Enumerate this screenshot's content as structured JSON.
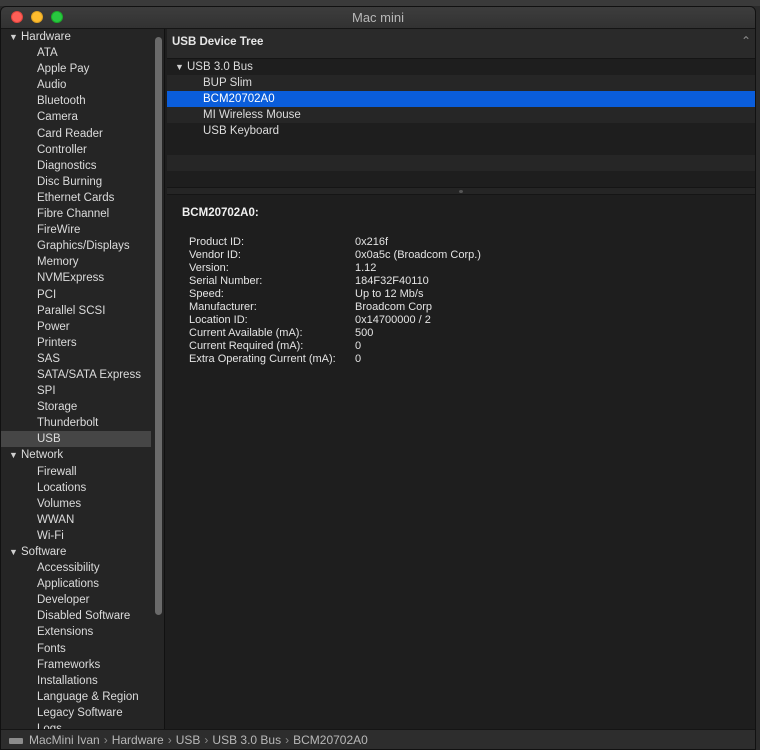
{
  "window": {
    "title": "Mac mini"
  },
  "sidebar": {
    "groups": [
      {
        "label": "Hardware",
        "items": [
          "ATA",
          "Apple Pay",
          "Audio",
          "Bluetooth",
          "Camera",
          "Card Reader",
          "Controller",
          "Diagnostics",
          "Disc Burning",
          "Ethernet Cards",
          "Fibre Channel",
          "FireWire",
          "Graphics/Displays",
          "Memory",
          "NVMExpress",
          "PCI",
          "Parallel SCSI",
          "Power",
          "Printers",
          "SAS",
          "SATA/SATA Express",
          "SPI",
          "Storage",
          "Thunderbolt",
          "USB"
        ]
      },
      {
        "label": "Network",
        "items": [
          "Firewall",
          "Locations",
          "Volumes",
          "WWAN",
          "Wi-Fi"
        ]
      },
      {
        "label": "Software",
        "items": [
          "Accessibility",
          "Applications",
          "Developer",
          "Disabled Software",
          "Extensions",
          "Fonts",
          "Frameworks",
          "Installations",
          "Language & Region",
          "Legacy Software",
          "Logs"
        ]
      }
    ],
    "selected_item": "USB"
  },
  "content": {
    "header": "USB Device Tree",
    "tree": {
      "bus": "USB 3.0 Bus",
      "devices": [
        "BUP Slim",
        "BCM20702A0",
        "MI Wireless Mouse",
        "USB Keyboard"
      ],
      "selected": "BCM20702A0"
    },
    "detail": {
      "title": "BCM20702A0:",
      "properties": [
        {
          "key": "Product ID:",
          "value": "0x216f"
        },
        {
          "key": "Vendor ID:",
          "value": "0x0a5c  (Broadcom Corp.)"
        },
        {
          "key": "Version:",
          "value": "1.12"
        },
        {
          "key": "Serial Number:",
          "value": "184F32F40110"
        },
        {
          "key": "Speed:",
          "value": "Up to 12 Mb/s"
        },
        {
          "key": "Manufacturer:",
          "value": "Broadcom Corp"
        },
        {
          "key": "Location ID:",
          "value": "0x14700000 / 2"
        },
        {
          "key": "Current Available (mA):",
          "value": "500"
        },
        {
          "key": "Current Required (mA):",
          "value": "0"
        },
        {
          "key": "Extra Operating Current (mA):",
          "value": "0"
        }
      ]
    }
  },
  "pathbar": {
    "crumbs": [
      "MacMini Ivan",
      "Hardware",
      "USB",
      "USB 3.0 Bus",
      "BCM20702A0"
    ],
    "separator": "›"
  },
  "icons": {
    "disclosure_open": "▼",
    "collapse_chevron": "⌃"
  }
}
